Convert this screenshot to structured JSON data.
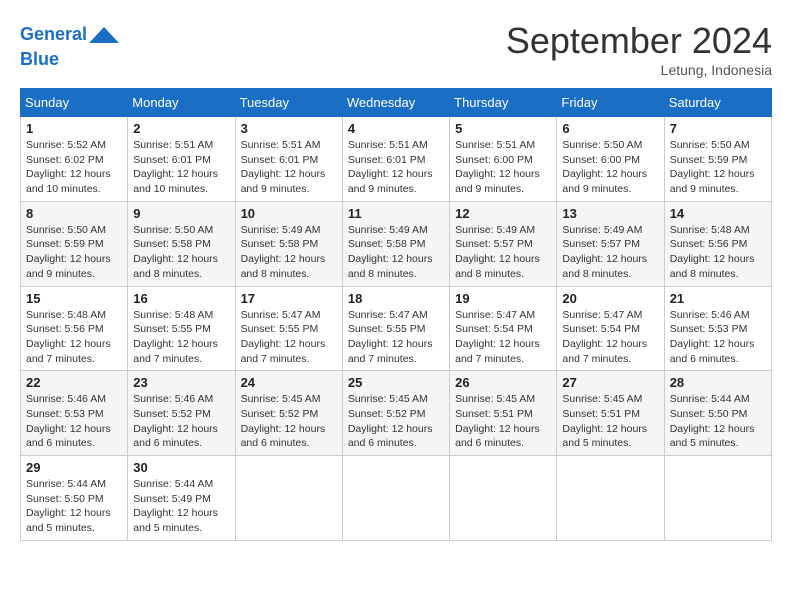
{
  "header": {
    "logo_line1": "General",
    "logo_line2": "Blue",
    "month_title": "September 2024",
    "location": "Letung, Indonesia"
  },
  "days_of_week": [
    "Sunday",
    "Monday",
    "Tuesday",
    "Wednesday",
    "Thursday",
    "Friday",
    "Saturday"
  ],
  "weeks": [
    [
      {
        "day": "1",
        "sunrise": "5:52 AM",
        "sunset": "6:02 PM",
        "daylight": "12 hours and 10 minutes."
      },
      {
        "day": "2",
        "sunrise": "5:51 AM",
        "sunset": "6:01 PM",
        "daylight": "12 hours and 10 minutes."
      },
      {
        "day": "3",
        "sunrise": "5:51 AM",
        "sunset": "6:01 PM",
        "daylight": "12 hours and 9 minutes."
      },
      {
        "day": "4",
        "sunrise": "5:51 AM",
        "sunset": "6:01 PM",
        "daylight": "12 hours and 9 minutes."
      },
      {
        "day": "5",
        "sunrise": "5:51 AM",
        "sunset": "6:00 PM",
        "daylight": "12 hours and 9 minutes."
      },
      {
        "day": "6",
        "sunrise": "5:50 AM",
        "sunset": "6:00 PM",
        "daylight": "12 hours and 9 minutes."
      },
      {
        "day": "7",
        "sunrise": "5:50 AM",
        "sunset": "5:59 PM",
        "daylight": "12 hours and 9 minutes."
      }
    ],
    [
      {
        "day": "8",
        "sunrise": "5:50 AM",
        "sunset": "5:59 PM",
        "daylight": "12 hours and 9 minutes."
      },
      {
        "day": "9",
        "sunrise": "5:50 AM",
        "sunset": "5:58 PM",
        "daylight": "12 hours and 8 minutes."
      },
      {
        "day": "10",
        "sunrise": "5:49 AM",
        "sunset": "5:58 PM",
        "daylight": "12 hours and 8 minutes."
      },
      {
        "day": "11",
        "sunrise": "5:49 AM",
        "sunset": "5:58 PM",
        "daylight": "12 hours and 8 minutes."
      },
      {
        "day": "12",
        "sunrise": "5:49 AM",
        "sunset": "5:57 PM",
        "daylight": "12 hours and 8 minutes."
      },
      {
        "day": "13",
        "sunrise": "5:49 AM",
        "sunset": "5:57 PM",
        "daylight": "12 hours and 8 minutes."
      },
      {
        "day": "14",
        "sunrise": "5:48 AM",
        "sunset": "5:56 PM",
        "daylight": "12 hours and 8 minutes."
      }
    ],
    [
      {
        "day": "15",
        "sunrise": "5:48 AM",
        "sunset": "5:56 PM",
        "daylight": "12 hours and 7 minutes."
      },
      {
        "day": "16",
        "sunrise": "5:48 AM",
        "sunset": "5:55 PM",
        "daylight": "12 hours and 7 minutes."
      },
      {
        "day": "17",
        "sunrise": "5:47 AM",
        "sunset": "5:55 PM",
        "daylight": "12 hours and 7 minutes."
      },
      {
        "day": "18",
        "sunrise": "5:47 AM",
        "sunset": "5:55 PM",
        "daylight": "12 hours and 7 minutes."
      },
      {
        "day": "19",
        "sunrise": "5:47 AM",
        "sunset": "5:54 PM",
        "daylight": "12 hours and 7 minutes."
      },
      {
        "day": "20",
        "sunrise": "5:47 AM",
        "sunset": "5:54 PM",
        "daylight": "12 hours and 7 minutes."
      },
      {
        "day": "21",
        "sunrise": "5:46 AM",
        "sunset": "5:53 PM",
        "daylight": "12 hours and 6 minutes."
      }
    ],
    [
      {
        "day": "22",
        "sunrise": "5:46 AM",
        "sunset": "5:53 PM",
        "daylight": "12 hours and 6 minutes."
      },
      {
        "day": "23",
        "sunrise": "5:46 AM",
        "sunset": "5:52 PM",
        "daylight": "12 hours and 6 minutes."
      },
      {
        "day": "24",
        "sunrise": "5:45 AM",
        "sunset": "5:52 PM",
        "daylight": "12 hours and 6 minutes."
      },
      {
        "day": "25",
        "sunrise": "5:45 AM",
        "sunset": "5:52 PM",
        "daylight": "12 hours and 6 minutes."
      },
      {
        "day": "26",
        "sunrise": "5:45 AM",
        "sunset": "5:51 PM",
        "daylight": "12 hours and 6 minutes."
      },
      {
        "day": "27",
        "sunrise": "5:45 AM",
        "sunset": "5:51 PM",
        "daylight": "12 hours and 5 minutes."
      },
      {
        "day": "28",
        "sunrise": "5:44 AM",
        "sunset": "5:50 PM",
        "daylight": "12 hours and 5 minutes."
      }
    ],
    [
      {
        "day": "29",
        "sunrise": "5:44 AM",
        "sunset": "5:50 PM",
        "daylight": "12 hours and 5 minutes."
      },
      {
        "day": "30",
        "sunrise": "5:44 AM",
        "sunset": "5:49 PM",
        "daylight": "12 hours and 5 minutes."
      },
      null,
      null,
      null,
      null,
      null
    ]
  ]
}
